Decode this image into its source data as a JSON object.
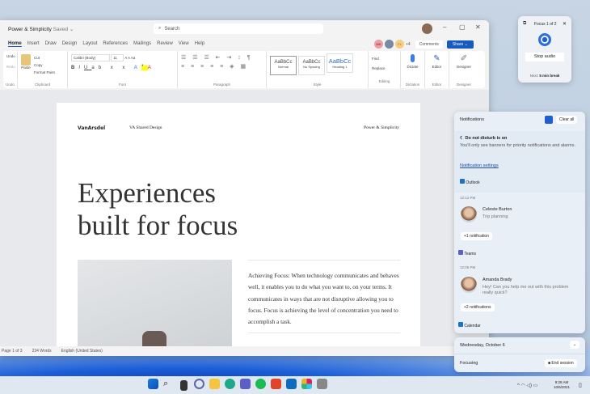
{
  "window": {
    "doc_title": "Power & Simplicity",
    "saved": "Saved ⌄",
    "search_placeholder": "Search",
    "minimize": "–",
    "maximize": "▢",
    "close": "✕"
  },
  "tabs": [
    "Home",
    "Insert",
    "Draw",
    "Design",
    "Layout",
    "References",
    "Mailings",
    "Review",
    "View",
    "Help"
  ],
  "collab": {
    "avatars": [
      "MK",
      "",
      "FL"
    ],
    "extra": "+4",
    "comments": "Comments",
    "share": "Share ⌄"
  },
  "ribbon": {
    "undo": {
      "undo": "Undo",
      "redo": "Redo",
      "label": "Undo"
    },
    "clipboard": {
      "paste": "Paste",
      "cut": "Cut",
      "copy": "Copy",
      "format_painter": "Format Paint",
      "label": "Clipboard"
    },
    "font": {
      "name": "Calibri (Body)",
      "size": "11",
      "label": "Font"
    },
    "paragraph": {
      "label": "Paragraph"
    },
    "styles": {
      "items": [
        {
          "sample": "AaBbCc",
          "name": "Normal"
        },
        {
          "sample": "AaBbCc",
          "name": "No Spacing"
        },
        {
          "sample": "AaBbCc",
          "name": "Heading 1"
        }
      ],
      "label": "Style"
    },
    "editing": {
      "find": "Find",
      "replace": "Replace",
      "label": "Editing"
    },
    "dictate": {
      "name": "Dictate",
      "label": "Dictation"
    },
    "editor": {
      "name": "Editor",
      "label": "Editor"
    },
    "designer": {
      "name": "Designer",
      "label": "Designer"
    }
  },
  "document": {
    "logo": "VanArsdel",
    "header_center": "VA Shared Design",
    "header_right": "Power & Simplicity",
    "heading_line1": "Experiences",
    "heading_line2": "built for focus",
    "body": "Achieving Focus: When technology communicates and behaves well, it enables you to do what you want to, on your terms. It communicates in ways that are not disruptive allowing you to focus. Focus is achieving the level of concentration you need to accomplish a task."
  },
  "statusbar": {
    "page": "Page 1 of 3",
    "words": "234 Words",
    "language": "English (United States)"
  },
  "focus_widget": {
    "title": "Focus 1 of 2",
    "close": "✕",
    "stop_audio": "Stop audio",
    "next_prefix": "Next:",
    "next_value": "5 min break"
  },
  "notifications": {
    "title": "Notifications",
    "clear_all": "Clear all",
    "dnd_title": "Do not disturb is on",
    "dnd_text": "You'll only see banners for priority notifications and alarms.",
    "settings_link": "Notification settings",
    "groups": [
      {
        "app": "Outlook",
        "time": "12:12 PM",
        "sender": "Celeste Burton",
        "message": "Trip planning",
        "more": "+1 notification"
      },
      {
        "app": "Teams",
        "time": "12:05 PM",
        "sender": "Amanda Brady",
        "message": "Hey! Can you help me out with this problem really quick?",
        "more": "+2 notifications"
      }
    ],
    "calendar_app": "Calendar"
  },
  "calendar": {
    "date": "Wednesday, October 6",
    "focusing": "Focusing",
    "end_session": "End session"
  },
  "taskbar": {
    "time": "9:28 AM",
    "date": "10/6/2021",
    "apps": [
      "start",
      "search",
      "file-explorer",
      "chat",
      "folder",
      "edge",
      "teams",
      "spotify",
      "office",
      "outlook",
      "slack",
      "store"
    ]
  }
}
